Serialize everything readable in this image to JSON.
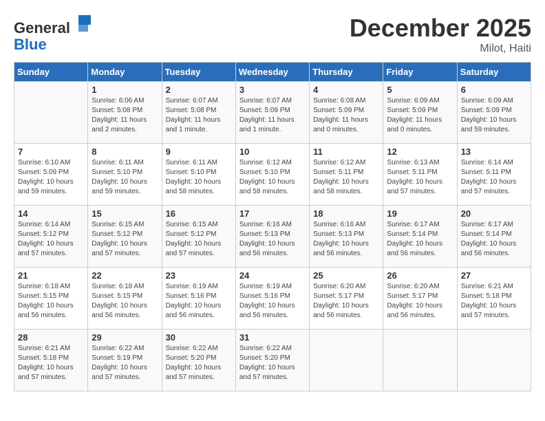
{
  "header": {
    "logo_general": "General",
    "logo_blue": "Blue",
    "month_title": "December 2025",
    "location": "Milot, Haiti"
  },
  "weekdays": [
    "Sunday",
    "Monday",
    "Tuesday",
    "Wednesday",
    "Thursday",
    "Friday",
    "Saturday"
  ],
  "weeks": [
    [
      {
        "day": "",
        "sunrise": "",
        "sunset": "",
        "daylight": ""
      },
      {
        "day": "1",
        "sunrise": "Sunrise: 6:06 AM",
        "sunset": "Sunset: 5:08 PM",
        "daylight": "Daylight: 11 hours and 2 minutes."
      },
      {
        "day": "2",
        "sunrise": "Sunrise: 6:07 AM",
        "sunset": "Sunset: 5:08 PM",
        "daylight": "Daylight: 11 hours and 1 minute."
      },
      {
        "day": "3",
        "sunrise": "Sunrise: 6:07 AM",
        "sunset": "Sunset: 5:09 PM",
        "daylight": "Daylight: 11 hours and 1 minute."
      },
      {
        "day": "4",
        "sunrise": "Sunrise: 6:08 AM",
        "sunset": "Sunset: 5:09 PM",
        "daylight": "Daylight: 11 hours and 0 minutes."
      },
      {
        "day": "5",
        "sunrise": "Sunrise: 6:09 AM",
        "sunset": "Sunset: 5:09 PM",
        "daylight": "Daylight: 11 hours and 0 minutes."
      },
      {
        "day": "6",
        "sunrise": "Sunrise: 6:09 AM",
        "sunset": "Sunset: 5:09 PM",
        "daylight": "Daylight: 10 hours and 59 minutes."
      }
    ],
    [
      {
        "day": "7",
        "sunrise": "Sunrise: 6:10 AM",
        "sunset": "Sunset: 5:09 PM",
        "daylight": "Daylight: 10 hours and 59 minutes."
      },
      {
        "day": "8",
        "sunrise": "Sunrise: 6:11 AM",
        "sunset": "Sunset: 5:10 PM",
        "daylight": "Daylight: 10 hours and 59 minutes."
      },
      {
        "day": "9",
        "sunrise": "Sunrise: 6:11 AM",
        "sunset": "Sunset: 5:10 PM",
        "daylight": "Daylight: 10 hours and 58 minutes."
      },
      {
        "day": "10",
        "sunrise": "Sunrise: 6:12 AM",
        "sunset": "Sunset: 5:10 PM",
        "daylight": "Daylight: 10 hours and 58 minutes."
      },
      {
        "day": "11",
        "sunrise": "Sunrise: 6:12 AM",
        "sunset": "Sunset: 5:11 PM",
        "daylight": "Daylight: 10 hours and 58 minutes."
      },
      {
        "day": "12",
        "sunrise": "Sunrise: 6:13 AM",
        "sunset": "Sunset: 5:11 PM",
        "daylight": "Daylight: 10 hours and 57 minutes."
      },
      {
        "day": "13",
        "sunrise": "Sunrise: 6:14 AM",
        "sunset": "Sunset: 5:11 PM",
        "daylight": "Daylight: 10 hours and 57 minutes."
      }
    ],
    [
      {
        "day": "14",
        "sunrise": "Sunrise: 6:14 AM",
        "sunset": "Sunset: 5:12 PM",
        "daylight": "Daylight: 10 hours and 57 minutes."
      },
      {
        "day": "15",
        "sunrise": "Sunrise: 6:15 AM",
        "sunset": "Sunset: 5:12 PM",
        "daylight": "Daylight: 10 hours and 57 minutes."
      },
      {
        "day": "16",
        "sunrise": "Sunrise: 6:15 AM",
        "sunset": "Sunset: 5:12 PM",
        "daylight": "Daylight: 10 hours and 57 minutes."
      },
      {
        "day": "17",
        "sunrise": "Sunrise: 6:16 AM",
        "sunset": "Sunset: 5:13 PM",
        "daylight": "Daylight: 10 hours and 56 minutes."
      },
      {
        "day": "18",
        "sunrise": "Sunrise: 6:16 AM",
        "sunset": "Sunset: 5:13 PM",
        "daylight": "Daylight: 10 hours and 56 minutes."
      },
      {
        "day": "19",
        "sunrise": "Sunrise: 6:17 AM",
        "sunset": "Sunset: 5:14 PM",
        "daylight": "Daylight: 10 hours and 56 minutes."
      },
      {
        "day": "20",
        "sunrise": "Sunrise: 6:17 AM",
        "sunset": "Sunset: 5:14 PM",
        "daylight": "Daylight: 10 hours and 56 minutes."
      }
    ],
    [
      {
        "day": "21",
        "sunrise": "Sunrise: 6:18 AM",
        "sunset": "Sunset: 5:15 PM",
        "daylight": "Daylight: 10 hours and 56 minutes."
      },
      {
        "day": "22",
        "sunrise": "Sunrise: 6:18 AM",
        "sunset": "Sunset: 5:15 PM",
        "daylight": "Daylight: 10 hours and 56 minutes."
      },
      {
        "day": "23",
        "sunrise": "Sunrise: 6:19 AM",
        "sunset": "Sunset: 5:16 PM",
        "daylight": "Daylight: 10 hours and 56 minutes."
      },
      {
        "day": "24",
        "sunrise": "Sunrise: 6:19 AM",
        "sunset": "Sunset: 5:16 PM",
        "daylight": "Daylight: 10 hours and 56 minutes."
      },
      {
        "day": "25",
        "sunrise": "Sunrise: 6:20 AM",
        "sunset": "Sunset: 5:17 PM",
        "daylight": "Daylight: 10 hours and 56 minutes."
      },
      {
        "day": "26",
        "sunrise": "Sunrise: 6:20 AM",
        "sunset": "Sunset: 5:17 PM",
        "daylight": "Daylight: 10 hours and 56 minutes."
      },
      {
        "day": "27",
        "sunrise": "Sunrise: 6:21 AM",
        "sunset": "Sunset: 5:18 PM",
        "daylight": "Daylight: 10 hours and 57 minutes."
      }
    ],
    [
      {
        "day": "28",
        "sunrise": "Sunrise: 6:21 AM",
        "sunset": "Sunset: 5:18 PM",
        "daylight": "Daylight: 10 hours and 57 minutes."
      },
      {
        "day": "29",
        "sunrise": "Sunrise: 6:22 AM",
        "sunset": "Sunset: 5:19 PM",
        "daylight": "Daylight: 10 hours and 57 minutes."
      },
      {
        "day": "30",
        "sunrise": "Sunrise: 6:22 AM",
        "sunset": "Sunset: 5:20 PM",
        "daylight": "Daylight: 10 hours and 57 minutes."
      },
      {
        "day": "31",
        "sunrise": "Sunrise: 6:22 AM",
        "sunset": "Sunset: 5:20 PM",
        "daylight": "Daylight: 10 hours and 57 minutes."
      },
      {
        "day": "",
        "sunrise": "",
        "sunset": "",
        "daylight": ""
      },
      {
        "day": "",
        "sunrise": "",
        "sunset": "",
        "daylight": ""
      },
      {
        "day": "",
        "sunrise": "",
        "sunset": "",
        "daylight": ""
      }
    ]
  ]
}
